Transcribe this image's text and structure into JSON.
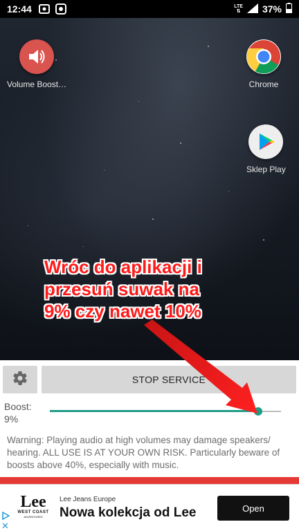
{
  "status_bar": {
    "time": "12:44",
    "network": "LTE",
    "battery": "37%"
  },
  "home_screen": {
    "apps": [
      {
        "label": "Volume Boost…",
        "icon": "speaker-icon",
        "color": "#d9534f"
      },
      {
        "label": "Chrome",
        "icon": "chrome-icon"
      },
      {
        "label": "Sklep Play",
        "icon": "play-store-icon"
      }
    ]
  },
  "annotation": {
    "line1": "Wróc do aplikacji i",
    "line2": "przesuń suwak na",
    "line3": "9% czy nawet 10%",
    "color": "#ff1a1a"
  },
  "booster": {
    "settings_icon": "gear-icon",
    "stop_label": "STOP SERVICE",
    "boost_label": "Boost:",
    "boost_value": "9%",
    "slider_fraction": 0.9,
    "accent_color": "#1f9a85",
    "warning": "Warning: Playing audio at high volumes may damage speakers/ hearing. ALL USE IS AT YOUR OWN RISK. Particularly beware of boosts above 40%, especially with music."
  },
  "ad": {
    "logo_main": "Lee",
    "logo_sub": "WEST COAST",
    "logo_tiny": "ADVENTURES",
    "brand": "Lee Jeans Europe",
    "headline": "Nowa kolekcja od Lee",
    "button": "Open"
  }
}
